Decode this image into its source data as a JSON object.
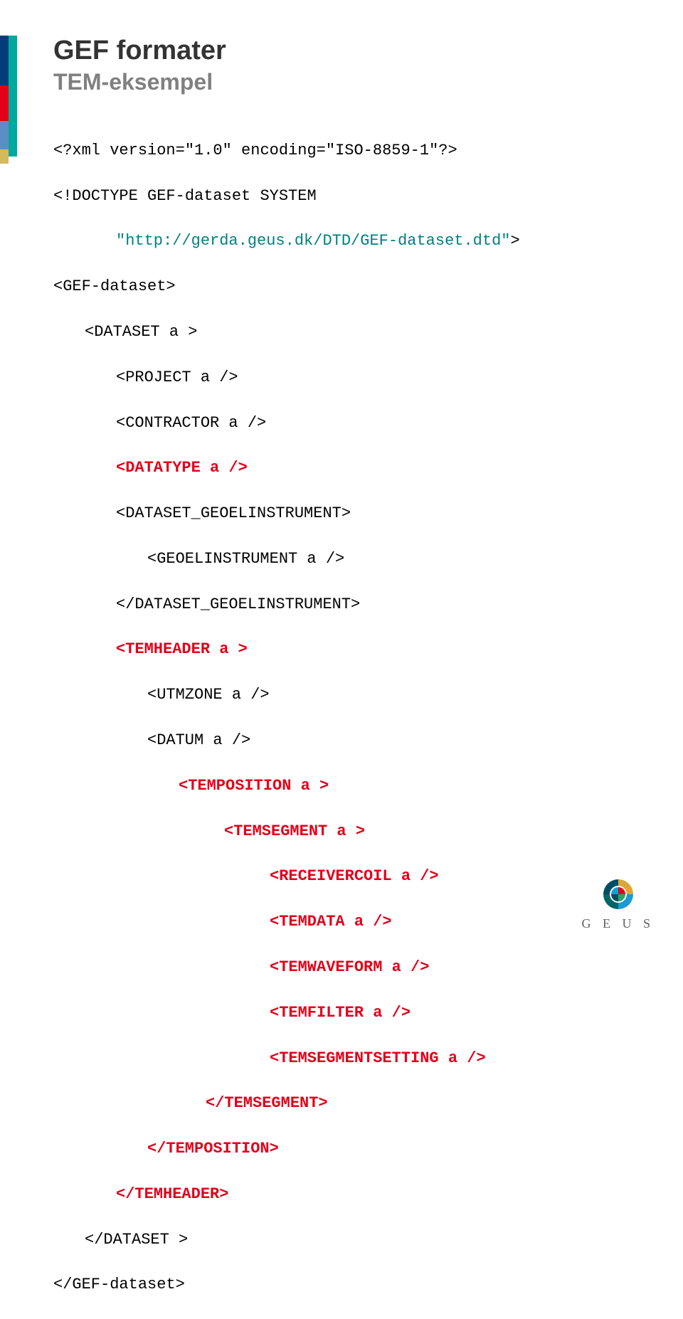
{
  "header": {
    "title": "GEF formater",
    "subtitle": "TEM-eksempel"
  },
  "code": {
    "l1": "<?xml version=\"1.0\" encoding=\"ISO-8859-1\"?>",
    "l2": "<!DOCTYPE GEF-dataset SYSTEM",
    "l3": "\"http://gerda.geus.dk/DTD/GEF-dataset.dtd\"",
    "l3b": ">",
    "l4": "<GEF-dataset>",
    "l5": "<DATASET a >",
    "l6": "<PROJECT a />",
    "l7": "<CONTRACTOR a />",
    "l8": "<DATATYPE a />",
    "l9": "<DATASET_GEOELINSTRUMENT>",
    "l10": "<GEOELINSTRUMENT a />",
    "l11": "</DATASET_GEOELINSTRUMENT>",
    "l12": "<TEMHEADER a >",
    "l13": "<UTMZONE a />",
    "l14": "<DATUM a />",
    "l15": "<TEMPOSITION a >",
    "l16": "<TEMSEGMENT a >",
    "l17": "<RECEIVERCOIL a />",
    "l18": "<TEMDATA a />",
    "l19": "<TEMWAVEFORM a />",
    "l20": "<TEMFILTER a />",
    "l21": "<TEMSEGMENTSETTING a />",
    "l22": "</TEMSEGMENT>",
    "l23": "</TEMPOSITION>",
    "l24": "</TEMHEADER>",
    "l25": "</DATASET >",
    "l26": "</GEF-dataset>"
  },
  "logo": {
    "text": "G E U S"
  }
}
